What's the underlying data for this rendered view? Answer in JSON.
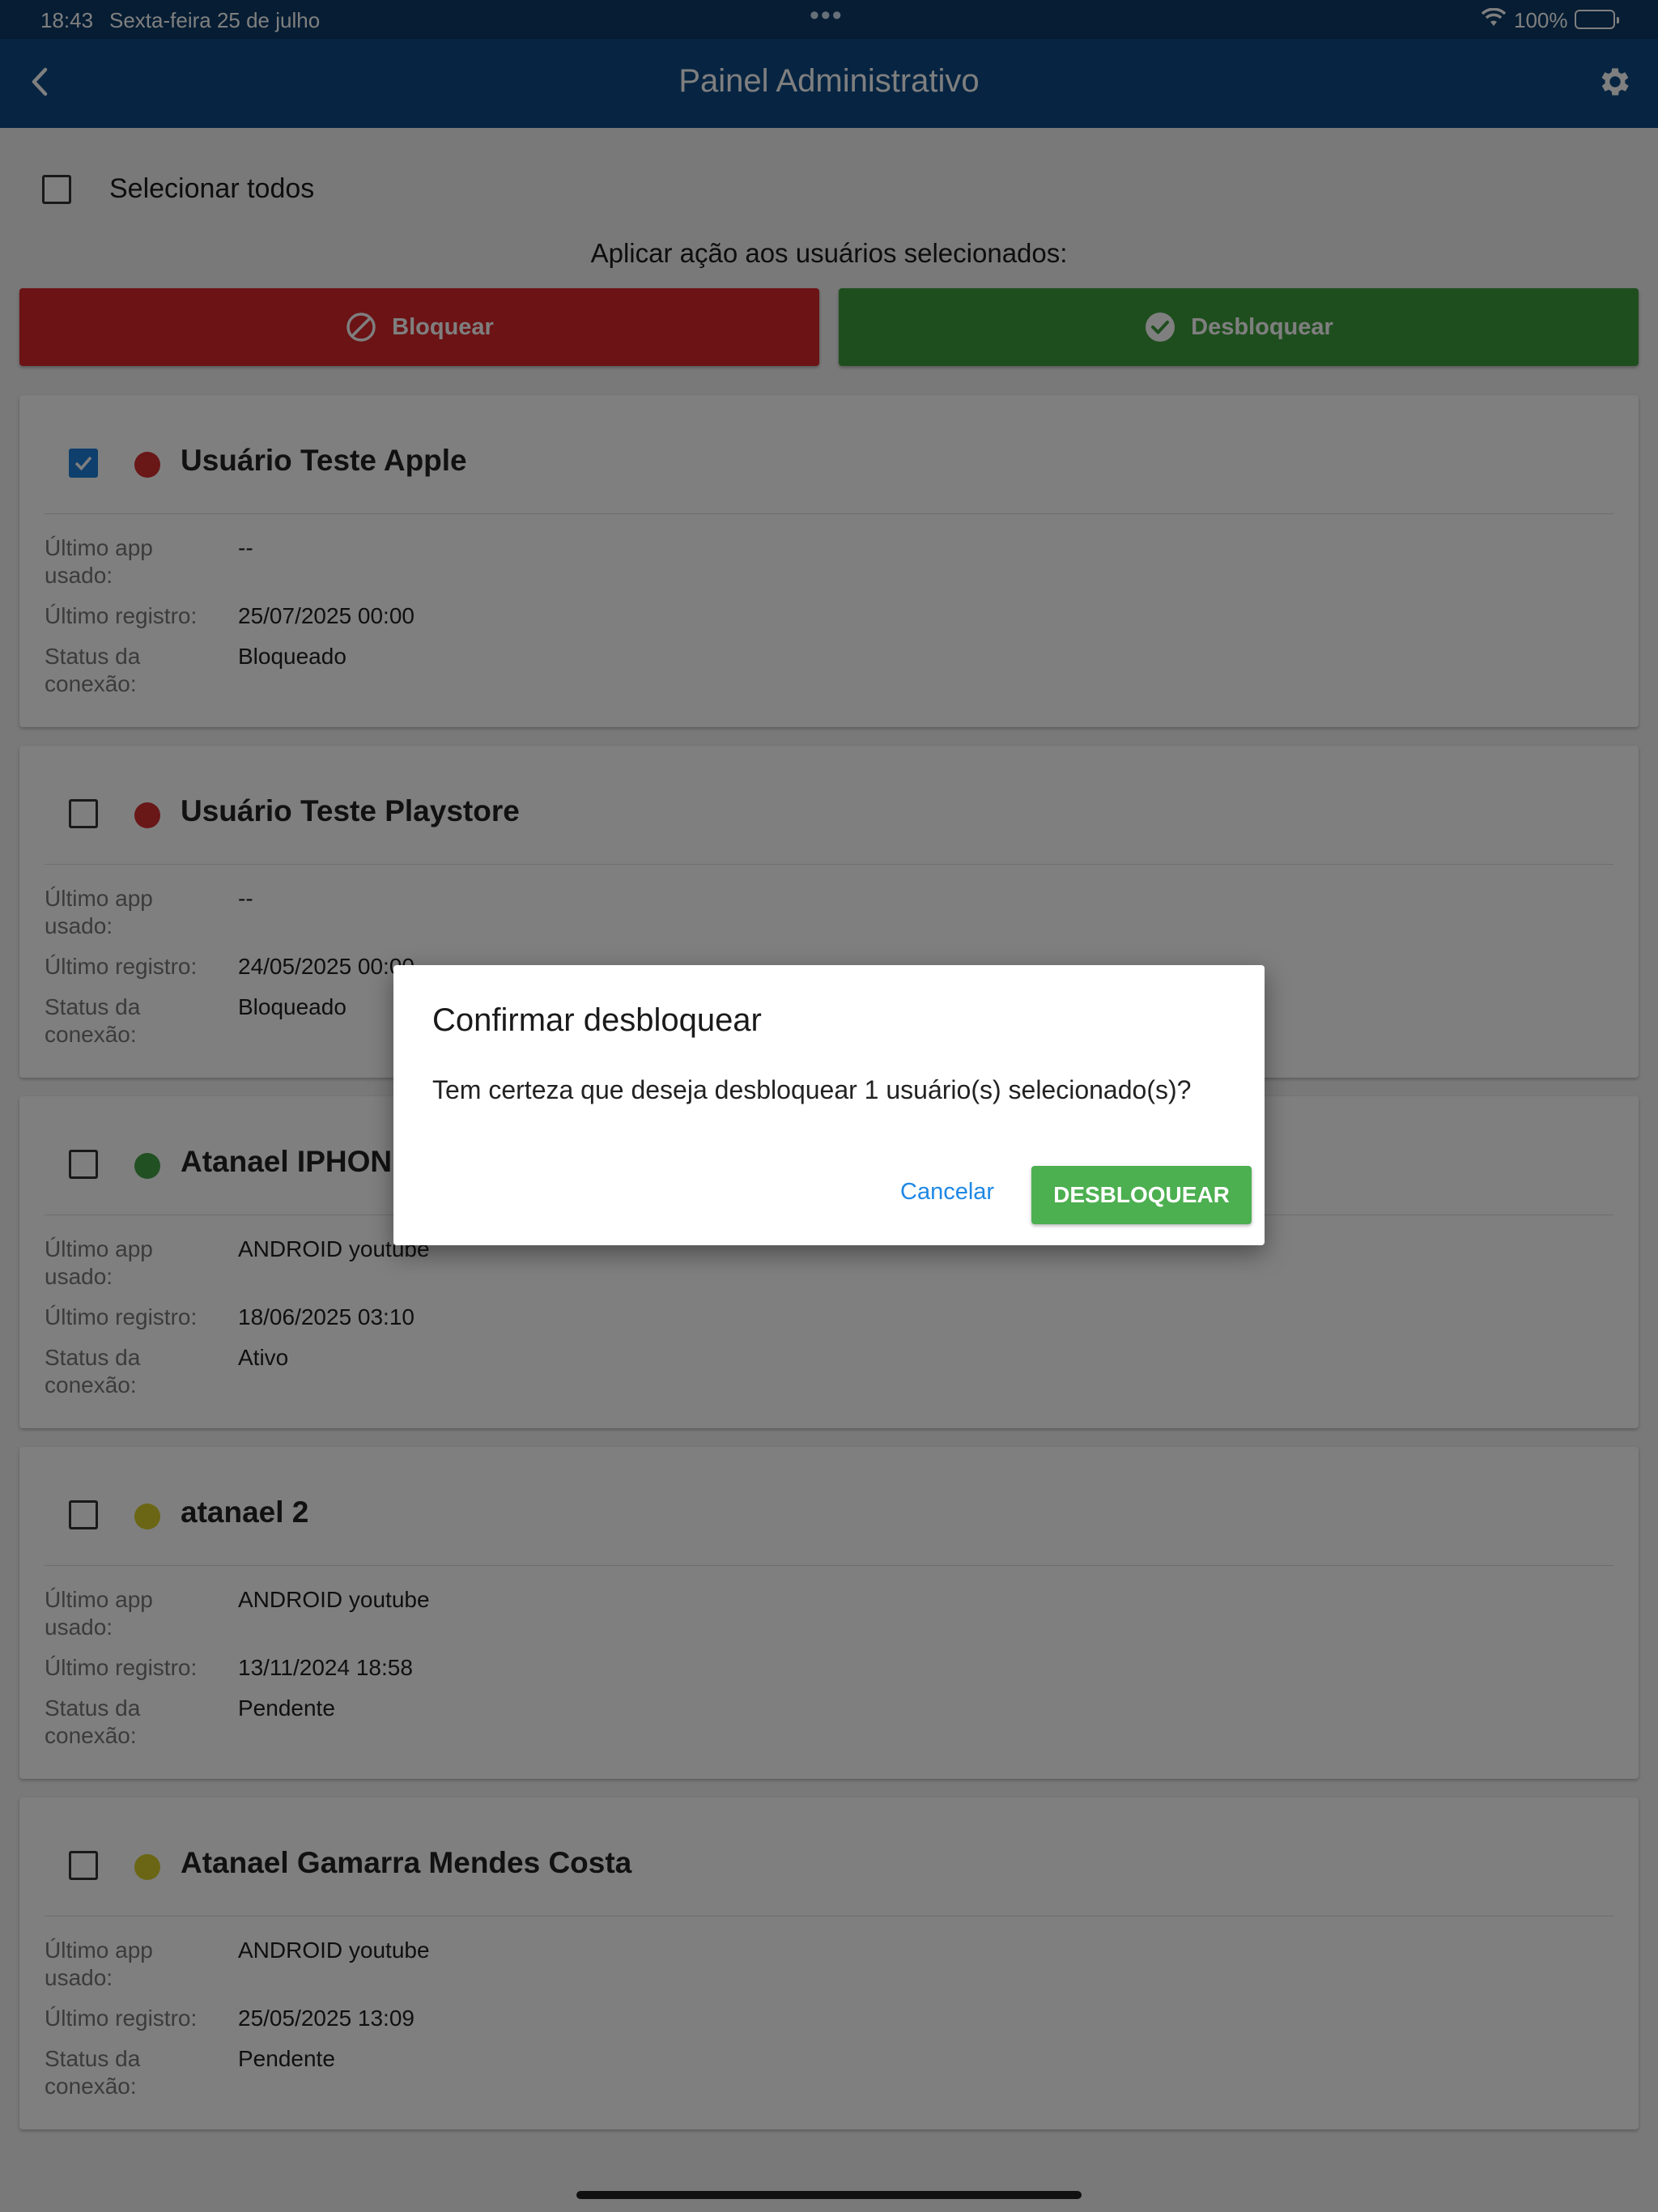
{
  "status_bar": {
    "time": "18:43",
    "date": "Sexta-feira 25 de julho",
    "dots": "•••",
    "battery": "100%"
  },
  "app_bar": {
    "title": "Painel Administrativo"
  },
  "select_all": {
    "label": "Selecionar todos",
    "checked": false
  },
  "apply_label": "Aplicar ação aos usuários selecionados:",
  "actions": {
    "block_label": "Bloquear",
    "block_color": "#d8262b",
    "unblock_label": "Desbloquear",
    "unblock_color": "#3e9c3d"
  },
  "labels": {
    "last_app": "Último app usado:",
    "last_record": "Último registro:",
    "connection_status": "Status da conexão:"
  },
  "users": [
    {
      "name": "Usuário Teste Apple",
      "checked": true,
      "status_color": "#d32f2f",
      "last_app": "--",
      "last_record": "25/07/2025 00:00",
      "connection_status": "Bloqueado"
    },
    {
      "name": "Usuário Teste Playstore",
      "checked": false,
      "status_color": "#d32f2f",
      "last_app": "--",
      "last_record": "24/05/2025 00:00",
      "connection_status": "Bloqueado"
    },
    {
      "name": "Atanael IPHONE",
      "checked": false,
      "status_color": "#43a047",
      "last_app": "ANDROID youtube",
      "last_record": "18/06/2025 03:10",
      "connection_status": "Ativo"
    },
    {
      "name": "atanael 2",
      "checked": false,
      "status_color": "#d6cc2a",
      "last_app": "ANDROID youtube",
      "last_record": "13/11/2024 18:58",
      "connection_status": "Pendente"
    },
    {
      "name": "Atanael Gamarra Mendes Costa",
      "checked": false,
      "status_color": "#d6cc2a",
      "last_app": "ANDROID youtube",
      "last_record": "25/05/2025 13:09",
      "connection_status": "Pendente"
    }
  ],
  "dialog": {
    "title": "Confirmar desbloquear",
    "message": "Tem certeza que deseja desbloquear 1 usuário(s) selecionado(s)?",
    "cancel_label": "Cancelar",
    "confirm_label": "DESBLOQUEAR",
    "confirm_color": "#4caf50"
  }
}
